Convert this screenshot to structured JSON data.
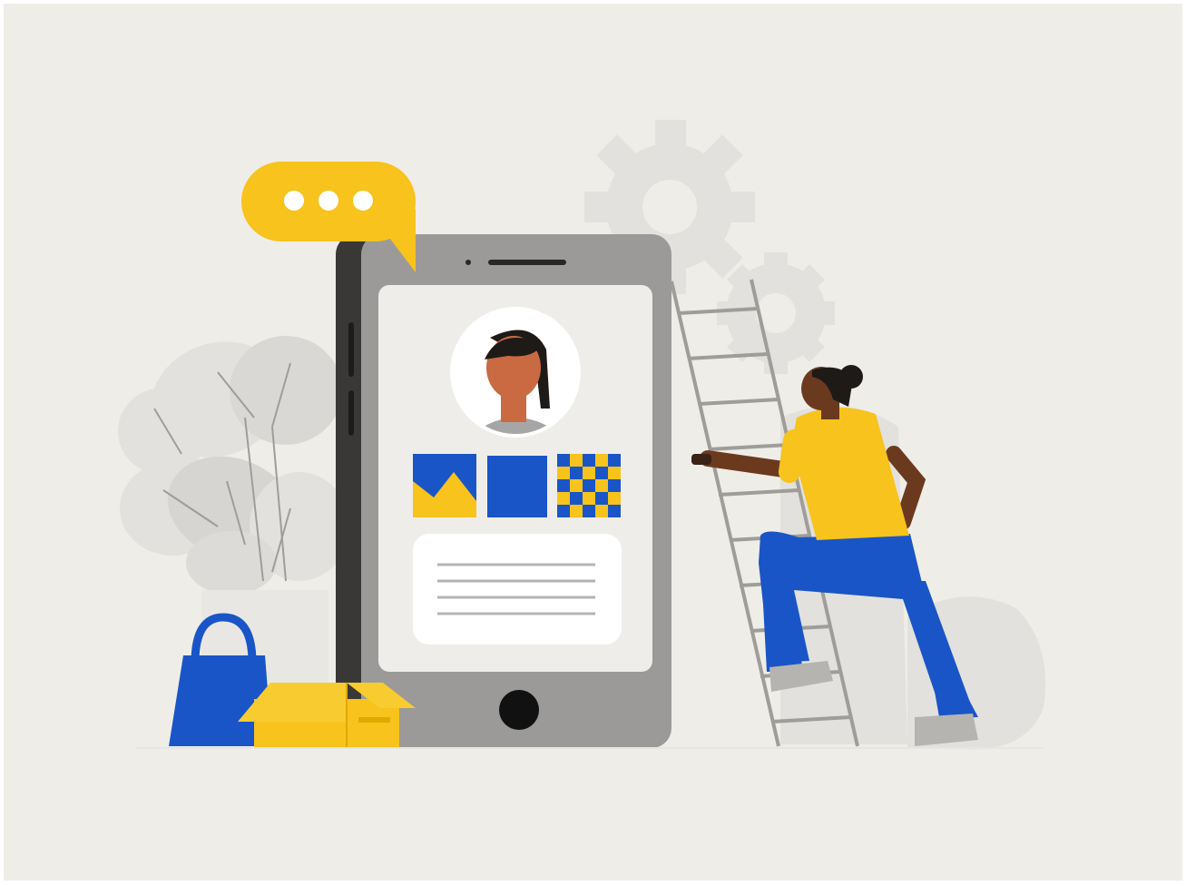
{
  "illustration": {
    "palette": {
      "background": "#efede8",
      "gray_light": "#e2e1de",
      "gray_mid": "#d6d5d2",
      "phone_body": "#9c9a98",
      "phone_dark": "#3a3836",
      "screen": "#efedea",
      "yellow": "#f7c31c",
      "blue": "#1955c6",
      "skin_profile": "#c96a42",
      "skin_person": "#6b3a1e",
      "hair": "#1e1a18",
      "white": "#ffffff"
    },
    "icons": [
      "chat-bubble-icon",
      "gear-icon",
      "leaf-plant-icon",
      "shopping-bag-icon",
      "box-icon",
      "ladder-icon",
      "profile-avatar-icon",
      "image-thumbnail-icon"
    ]
  }
}
